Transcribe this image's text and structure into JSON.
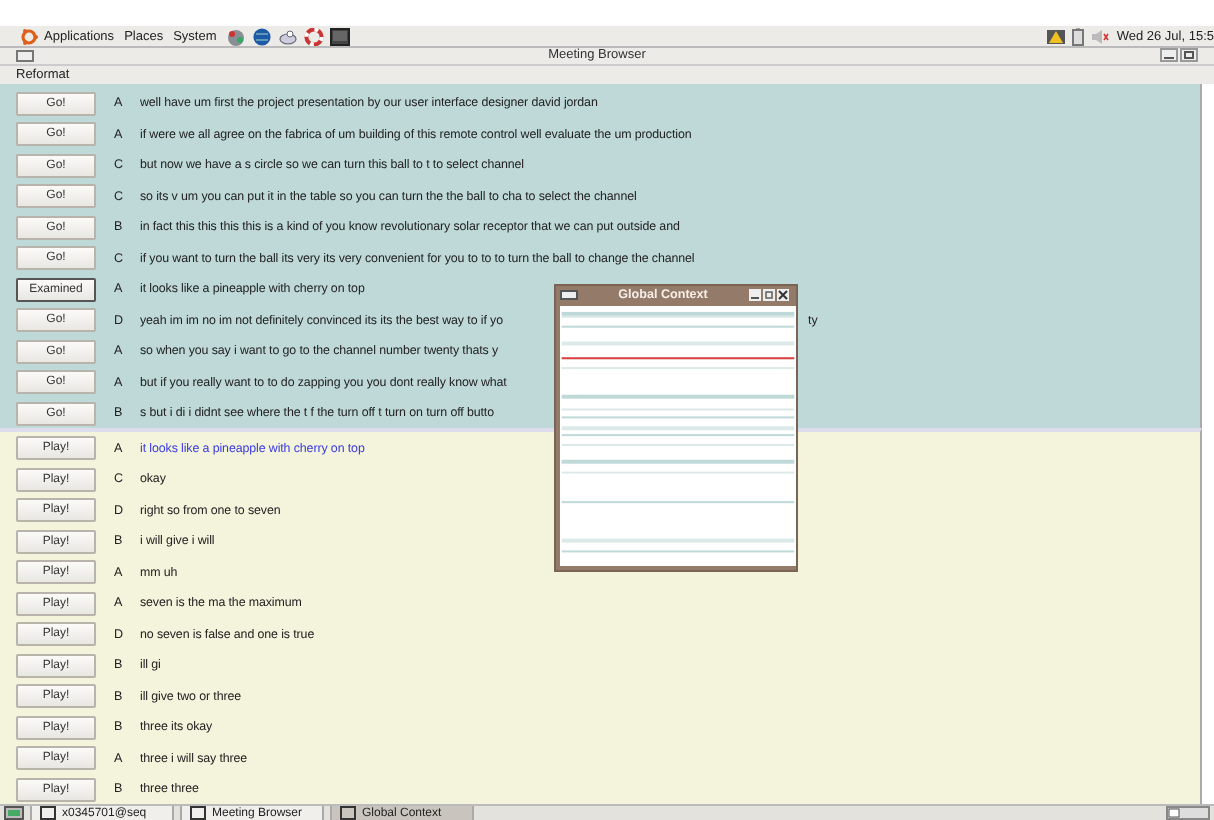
{
  "top_panel": {
    "menus": [
      "Applications",
      "Places",
      "System"
    ],
    "clock": "Wed 26 Jul, 15:5"
  },
  "window": {
    "title": "Meeting Browser"
  },
  "menu": [
    "Reformat"
  ],
  "reviewed_rows": [
    {
      "button": "Go!",
      "focused": false,
      "speaker": "A",
      "text": "well have um first the project presentation by our user interface designer  david jordan"
    },
    {
      "button": "Go!",
      "focused": false,
      "speaker": "A",
      "text": "if were we all agree on the fabrica of um building of this remote control  well evaluate the um production"
    },
    {
      "button": "Go!",
      "focused": false,
      "speaker": "C",
      "text": "but now we have a s circle  so we can turn this ball to t to select channel"
    },
    {
      "button": "Go!",
      "focused": false,
      "speaker": "C",
      "text": "so its v um  you can put it in the table so you can turn the the ball to cha to select the channel"
    },
    {
      "button": "Go!",
      "focused": false,
      "speaker": "B",
      "text": "in fact this this this this is a kind of you know revolutionary solar receptor that we can put outside and"
    },
    {
      "button": "Go!",
      "focused": false,
      "speaker": "C",
      "text": "if you want to turn the ball  its very its very convenient for you to to to turn the ball to change the channel"
    },
    {
      "button": "Examined",
      "focused": true,
      "speaker": "A",
      "text": "it looks like a pineapple with cherry on top"
    },
    {
      "button": "Go!",
      "focused": false,
      "speaker": "D",
      "text": "yeah im im no im not definitely convinced its its the best way to if yo",
      "tail": "ty"
    },
    {
      "button": "Go!",
      "focused": false,
      "speaker": "A",
      "text": "so  when you say i want to go to the channel number twenty thats y"
    },
    {
      "button": "Go!",
      "focused": false,
      "speaker": "A",
      "text": "but if you really want to to do zapping you you dont really know what"
    },
    {
      "button": "Go!",
      "focused": false,
      "speaker": "B",
      "text": "s but i di i didnt see where the t f the turn off t turn on turn off butto"
    }
  ],
  "play_rows": [
    {
      "button": "Play!",
      "selected": true,
      "speaker": "A",
      "text": "it looks like a pineapple with cherry on top"
    },
    {
      "button": "Play!",
      "selected": false,
      "speaker": "C",
      "text": "okay"
    },
    {
      "button": "Play!",
      "selected": false,
      "speaker": "D",
      "text": "right  so  from one to seven"
    },
    {
      "button": "Play!",
      "selected": false,
      "speaker": "B",
      "text": "i will give i will"
    },
    {
      "button": "Play!",
      "selected": false,
      "speaker": "A",
      "text": "mm uh"
    },
    {
      "button": "Play!",
      "selected": false,
      "speaker": "A",
      "text": "seven is the ma the maximum"
    },
    {
      "button": "Play!",
      "selected": false,
      "speaker": "D",
      "text": "no  seven is false and one is true"
    },
    {
      "button": "Play!",
      "selected": false,
      "speaker": "B",
      "text": "ill gi"
    },
    {
      "button": "Play!",
      "selected": false,
      "speaker": "B",
      "text": "ill give two or three"
    },
    {
      "button": "Play!",
      "selected": false,
      "speaker": "B",
      "text": "three  its okay"
    },
    {
      "button": "Play!",
      "selected": false,
      "speaker": "A",
      "text": "three  i will say three"
    },
    {
      "button": "Play!",
      "selected": false,
      "speaker": "B",
      "text": "three  three"
    }
  ],
  "context_window": {
    "title": "Global Context"
  },
  "taskbar": [
    {
      "label": "x0345701@seq",
      "selected": false
    },
    {
      "label": "Meeting Browser",
      "selected": false
    },
    {
      "label": "Global Context",
      "selected": true
    }
  ]
}
